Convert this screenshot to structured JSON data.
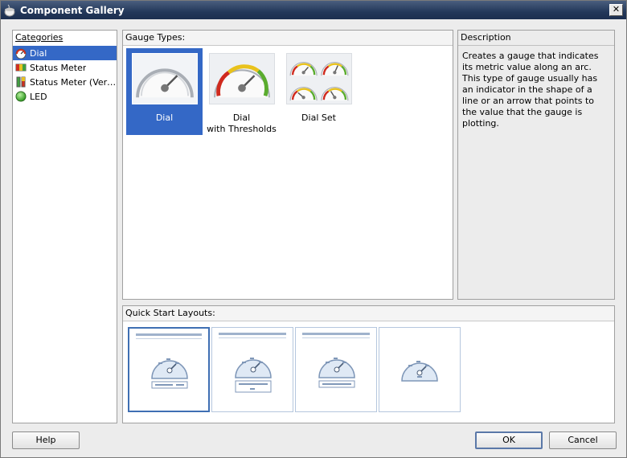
{
  "window": {
    "title": "Component Gallery",
    "close": "✕"
  },
  "categories": {
    "header": "Categories",
    "items": [
      {
        "label": "Dial",
        "icon": "dial-gauge-icon",
        "selected": true
      },
      {
        "label": "Status Meter",
        "icon": "status-meter-icon"
      },
      {
        "label": "Status Meter (Vertical)",
        "display": "Status Meter (Verti...",
        "icon": "vertical-status-meter-icon"
      },
      {
        "label": "LED",
        "icon": "led-icon"
      }
    ]
  },
  "gauge_types": {
    "header": "Gauge Types:",
    "items": [
      {
        "line1": "Dial",
        "line2": "",
        "selected": true
      },
      {
        "line1": "Dial",
        "line2": "with Thresholds"
      },
      {
        "line1": "Dial Set",
        "line2": ""
      }
    ]
  },
  "description": {
    "header": "Description",
    "text": "Creates a gauge that indicates its metric value along an arc. This type of gauge usually has an indicator in the shape of a line or an arrow that points to the value that the gauge is plotting."
  },
  "quick_start": {
    "header": "Quick Start Layouts:",
    "layouts": [
      "layout-1",
      "layout-2",
      "layout-3",
      "layout-4"
    ]
  },
  "buttons": {
    "help": "Help",
    "ok": "OK",
    "cancel": "Cancel"
  },
  "colors": {
    "selection": "#3468c6",
    "titlebar": "#23385a"
  }
}
